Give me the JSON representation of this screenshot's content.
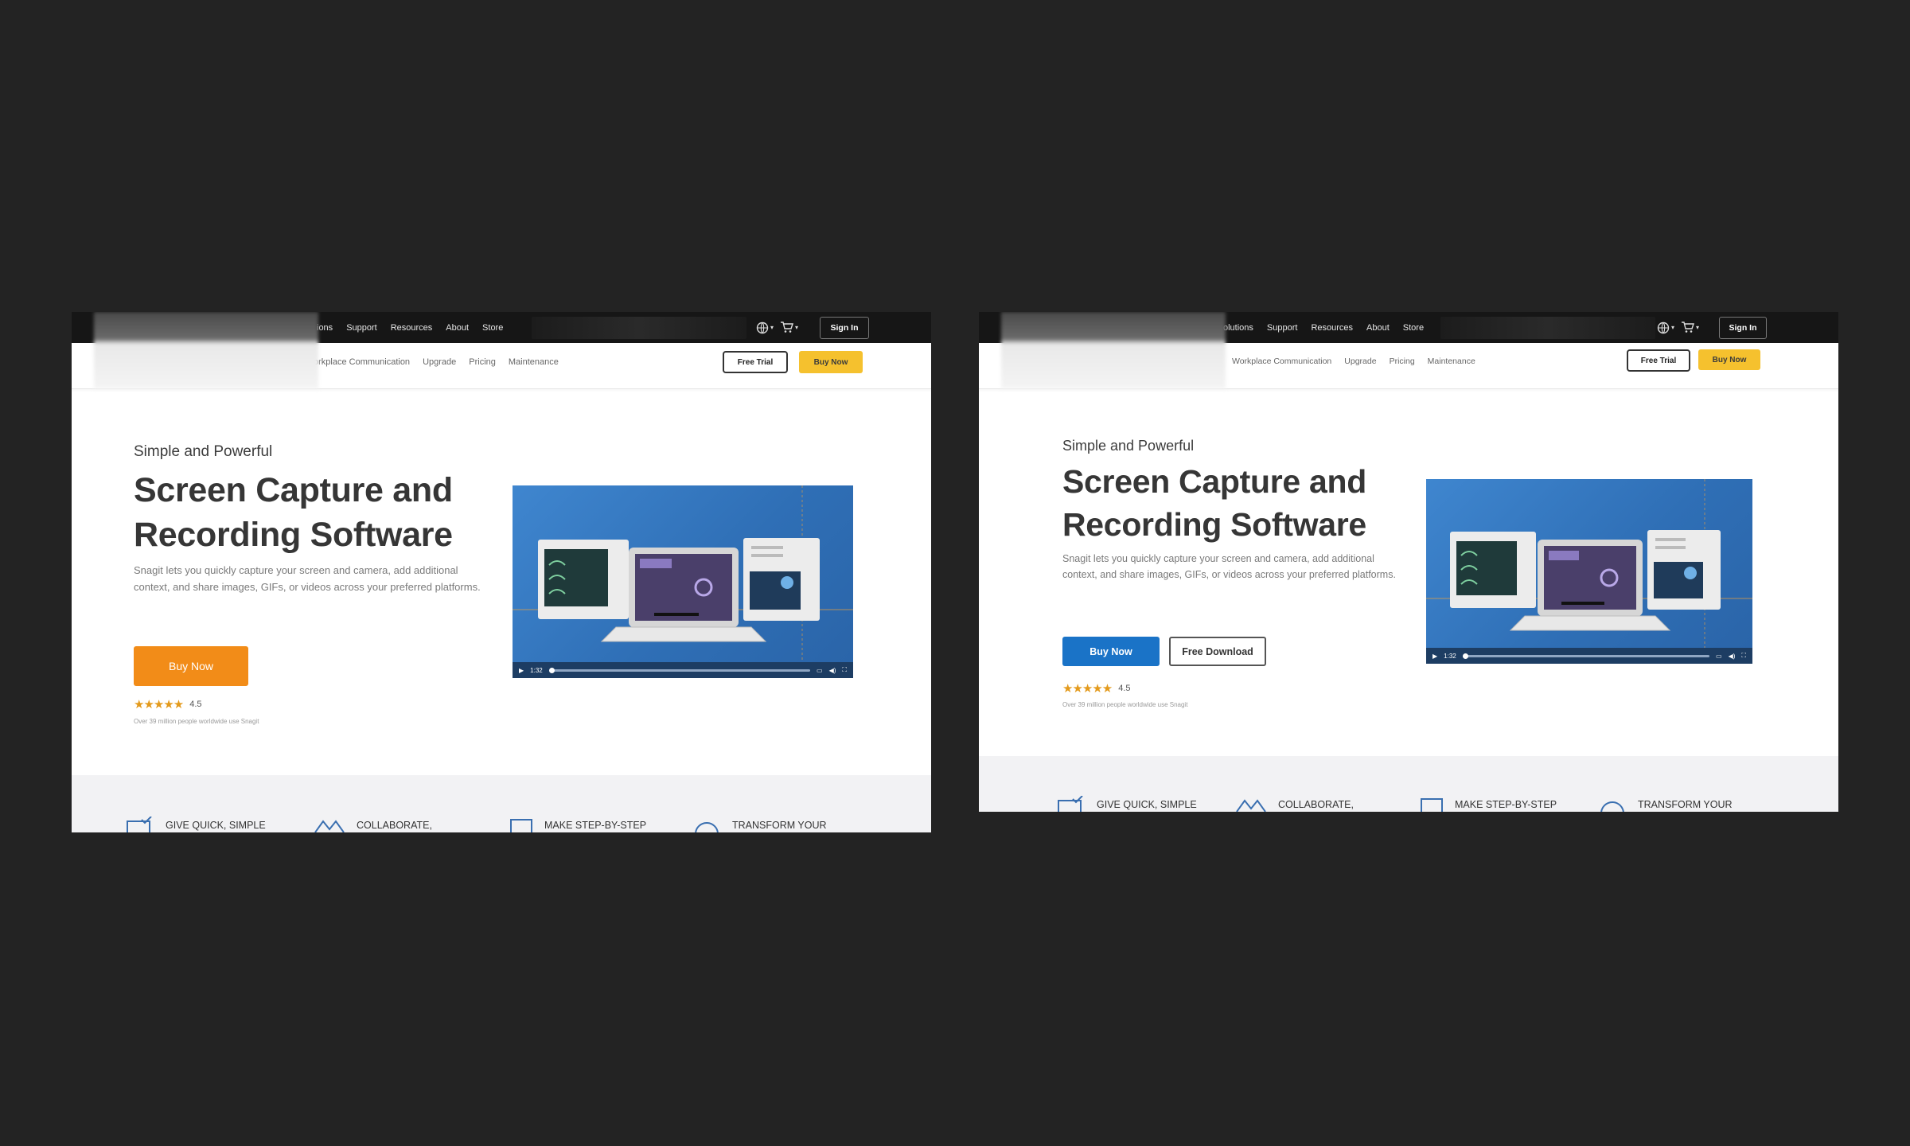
{
  "screens": [
    {
      "topnav": [
        "ions",
        "Support",
        "Resources",
        "About",
        "Store"
      ],
      "signin": "Sign In",
      "subnav": [
        "orkplace Communication",
        "Upgrade",
        "Pricing",
        "Maintenance"
      ],
      "free_trial": "Free Trial",
      "buy_now_nav": "Buy Now",
      "eyebrow": "Simple and Powerful",
      "headline_1": "Screen Capture and",
      "headline_2": "Recording Software",
      "description": "Snagit lets you quickly capture your screen and camera, add additional context, and share images, GIFs, or videos across your preferred platforms.",
      "primary_cta": "Buy Now",
      "rating": "4.5",
      "users_note": "Over 39 million people worldwide use Snagit",
      "video_time": "1:32",
      "features": [
        "GIVE QUICK, SIMPLE",
        "COLLABORATE,",
        "MAKE STEP-BY-STEP",
        "TRANSFORM YOUR"
      ]
    },
    {
      "topnav": [
        "olutions",
        "Support",
        "Resources",
        "About",
        "Store"
      ],
      "signin": "Sign In",
      "subnav": [
        "Workplace Communication",
        "Upgrade",
        "Pricing",
        "Maintenance"
      ],
      "free_trial": "Free Trial",
      "buy_now_nav": "Buy Now",
      "eyebrow": "Simple and Powerful",
      "headline_1": "Screen Capture and",
      "headline_2": "Recording Software",
      "description": "Snagit lets you quickly capture your screen and camera, add additional context, and share images, GIFs, or videos across your preferred platforms.",
      "primary_cta": "Buy Now",
      "secondary_cta": "Free Download",
      "rating": "4.5",
      "users_note": "Over 39 million people worldwide use Snagit",
      "video_time": "1:32",
      "features": [
        "GIVE QUICK, SIMPLE",
        "COLLABORATE,",
        "MAKE STEP-BY-STEP",
        "TRANSFORM YOUR"
      ]
    }
  ],
  "colors": {
    "background": "#232323",
    "orange_cta": "#f28c18",
    "blue_cta": "#1a73c7",
    "yellow_nav_button": "#f5c12e",
    "star_color": "#e39a1c",
    "video_blue": "#3f86cf"
  },
  "icons": [
    "globe-icon",
    "cart-icon",
    "play-icon",
    "captions-icon",
    "volume-icon",
    "fullscreen-icon",
    "star-icon"
  ]
}
